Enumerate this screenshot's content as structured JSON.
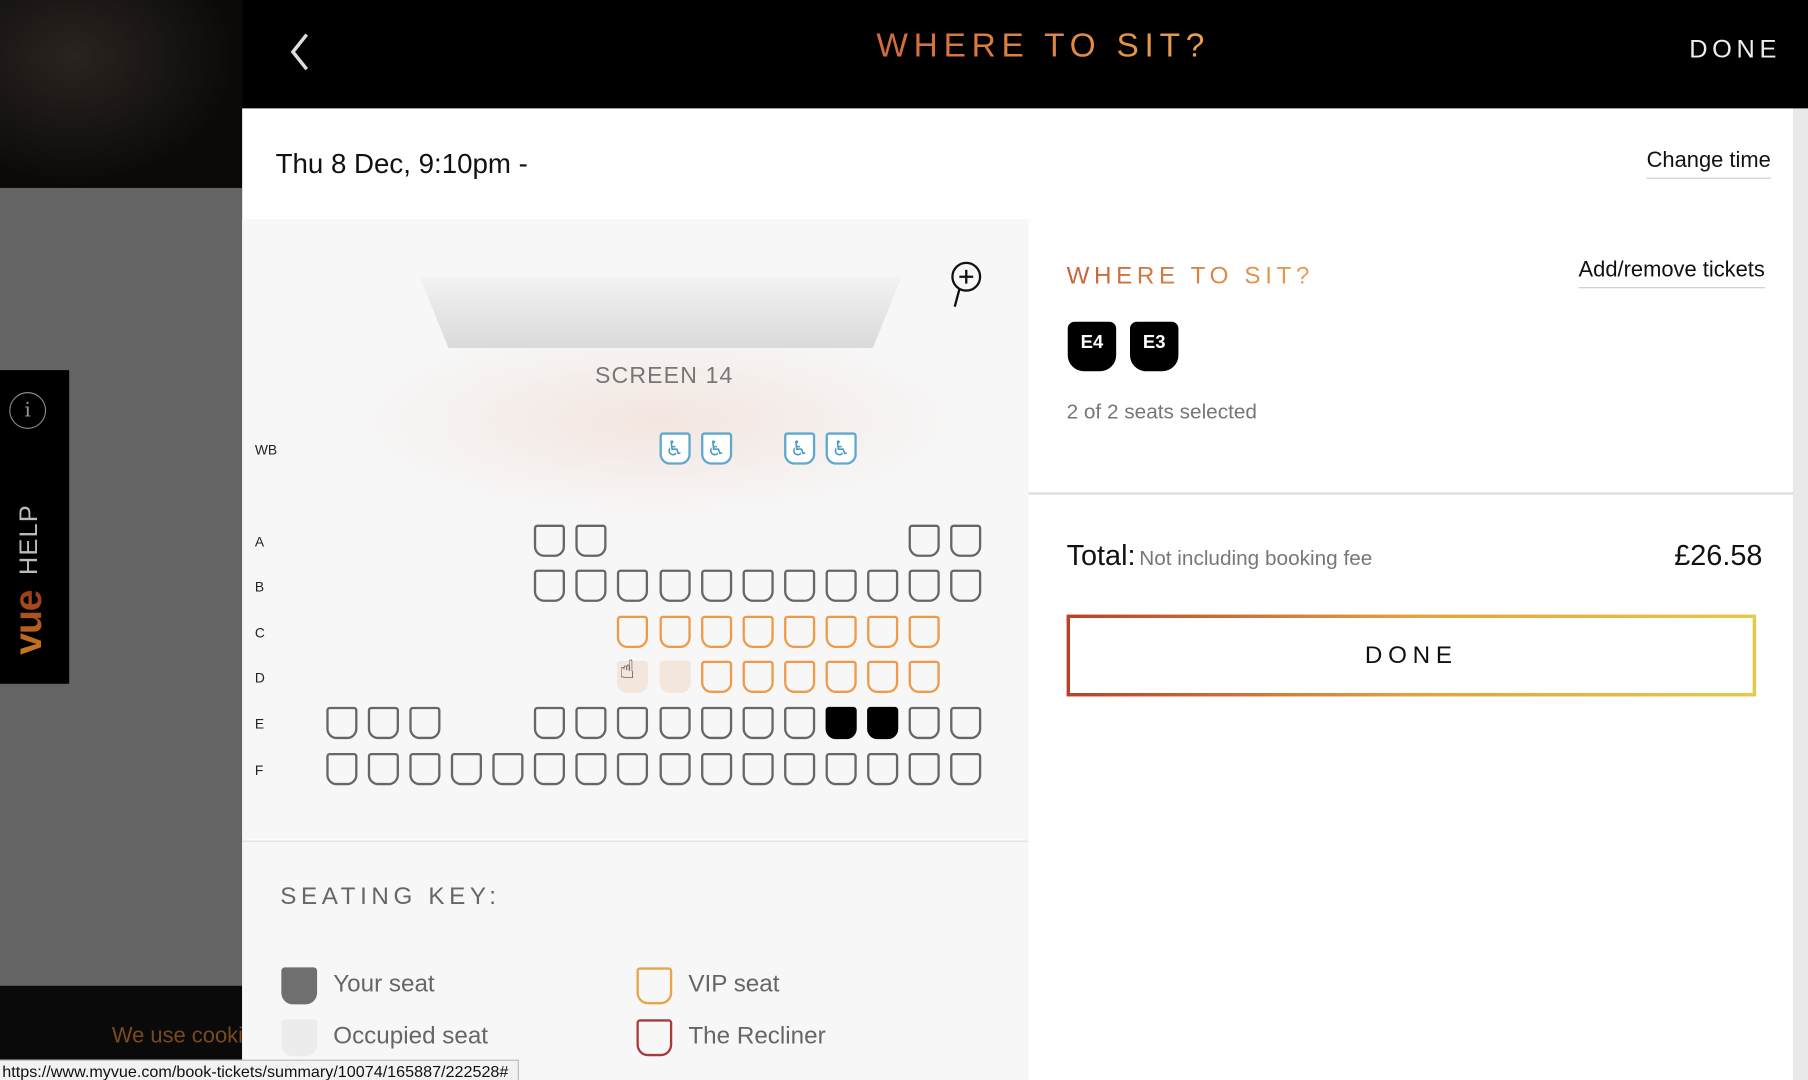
{
  "header": {
    "title": "WHERE TO SIT?",
    "done_label": "DONE",
    "back_icon": "chevron-left-icon"
  },
  "session": {
    "datetime": "Thu 8 Dec, 9:10pm -",
    "change_time_label": "Change time"
  },
  "sidebar": {
    "help_label": "HELP",
    "logo": "vue",
    "info_icon": "i",
    "cookie_text": "We use cookies"
  },
  "seat_map": {
    "screen_label": "SCREEN 14",
    "rows": [
      {
        "label": "WB",
        "seats": "--------WW-WW---"
      },
      {
        "label": "A",
        "seats": "-----SS-------SS"
      },
      {
        "label": "B",
        "seats": "-----SSSSSSSSSSS"
      },
      {
        "label": "C",
        "seats": "-------VVVVVVVV-"
      },
      {
        "label": "D",
        "seats": "-------OOVVVVVV-"
      },
      {
        "label": "E",
        "seats": "SSS--SSSSSSSYYSS"
      },
      {
        "label": "F",
        "seats": "SSSSSSSSSSSSSSSS"
      }
    ],
    "colors": {
      "standard": "#666666",
      "vip": "#ef9a4a",
      "occupied": "#f3e6dc",
      "yours": "#000000",
      "wheelchair": "#5fa8cf",
      "recliner": "#a83a3a"
    }
  },
  "seating_key": {
    "title": "SEATING KEY:",
    "items": [
      {
        "label": "Your seat"
      },
      {
        "label": "VIP seat"
      },
      {
        "label": "Occupied seat"
      },
      {
        "label": "The Recliner"
      }
    ]
  },
  "summary": {
    "title": "WHERE TO SIT?",
    "add_remove_label": "Add/remove tickets",
    "selected_seats": [
      "E4",
      "E3"
    ],
    "seats_count": "2 of 2 seats selected",
    "total_label": "Total:",
    "fee_note": "Not including booking fee",
    "price": "£26.58",
    "done_label": "DONE"
  },
  "status_bar": {
    "url": "https://www.myvue.com/book-tickets/summary/10074/165887/222528#"
  }
}
